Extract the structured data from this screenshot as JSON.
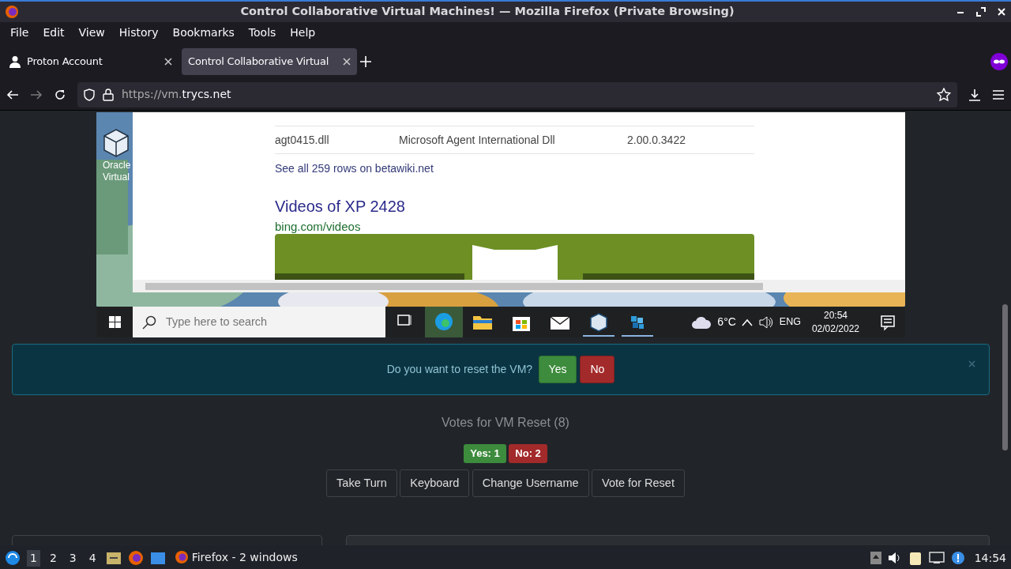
{
  "window": {
    "title": "Control Collaborative Virtual Machines! — Mozilla Firefox (Private Browsing)"
  },
  "menu": [
    "File",
    "Edit",
    "View",
    "History",
    "Bookmarks",
    "Tools",
    "Help"
  ],
  "tabs": [
    {
      "label": "Proton Account",
      "selected": false
    },
    {
      "label": "Control Collaborative Virtual",
      "selected": true
    }
  ],
  "url": {
    "prefix": "https://vm.",
    "domain": "trycs.net"
  },
  "vm": {
    "desktop_icon": [
      "Oracle",
      "Virtual"
    ],
    "rows": [
      {
        "file": "agt0415.dll",
        "description": "Microsoft Agent International Dll",
        "version": "2.00.0.3422"
      }
    ],
    "see_all": "See all 259 rows on betawiki.net",
    "video_title": "Videos of XP 2428",
    "video_source": "bing.com/videos",
    "taskbar": {
      "search_placeholder": "Type here to search",
      "weather": "6°C",
      "language": "ENG",
      "time": "20:54",
      "date": "02/02/2022"
    }
  },
  "alert": {
    "question": "Do you want to reset the VM?",
    "yes": "Yes",
    "no": "No"
  },
  "votes": {
    "title": "Votes for VM Reset (8)",
    "yes": "Yes: 1",
    "no": "No: 2"
  },
  "buttons": [
    "Take Turn",
    "Keyboard",
    "Change Username",
    "Vote for Reset"
  ],
  "panel": {
    "workspaces": [
      {
        "label": "1",
        "selected": true
      },
      {
        "label": "2",
        "selected": false
      },
      {
        "label": "3",
        "selected": false
      },
      {
        "label": "4",
        "selected": false
      }
    ],
    "window_button": "Firefox - 2 windows",
    "clock": "14:54"
  }
}
